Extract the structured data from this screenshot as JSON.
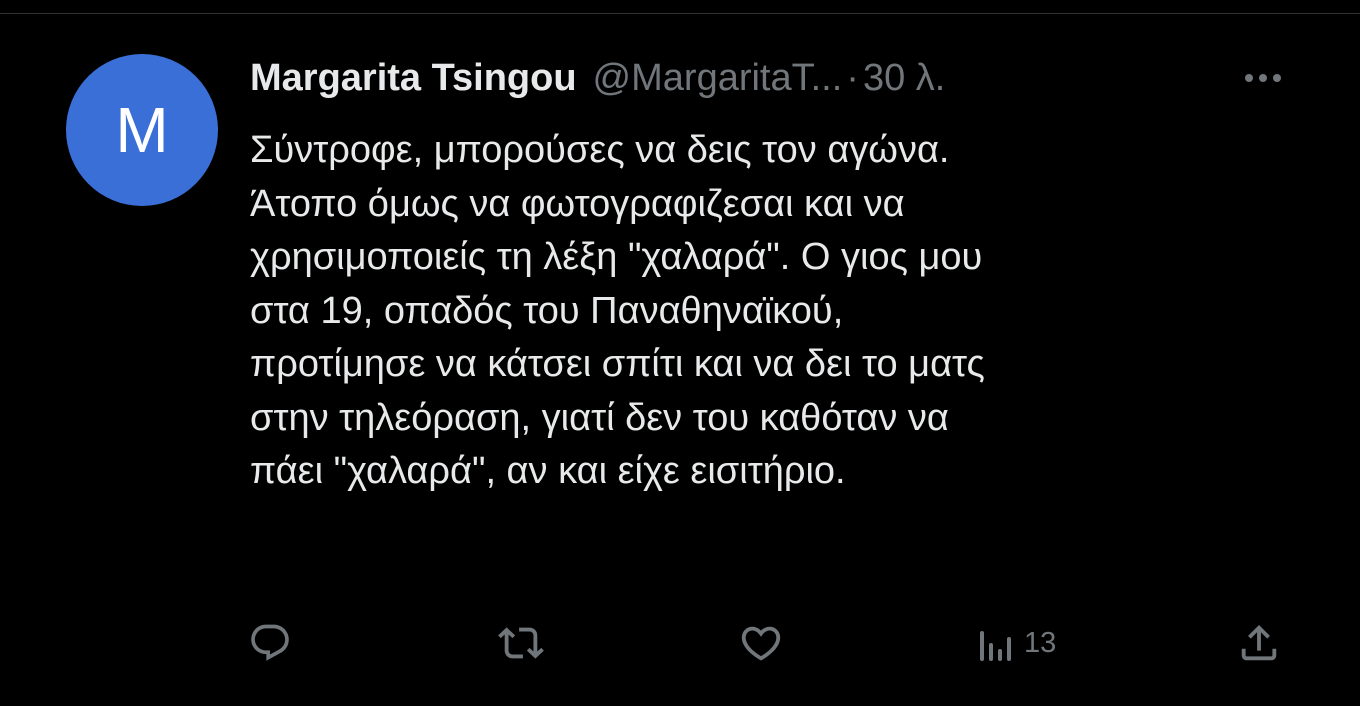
{
  "tweet": {
    "avatar_letter": "M",
    "author_name": "Margarita Tsingou",
    "author_handle": "@MargaritaT...",
    "separator": "·",
    "timestamp": "30 λ.",
    "text": "Σύντροφε, μπορούσες να δεις τον αγώνα.\nΆτοπο όμως να φωτογραφιζεσαι και να\nχρησιμοποιείς τη λέξη \"χαλαρά\". Ο γιος μου\nστα 19, οπαδός του Παναθηναϊκού,\nπροτίμησε να κάτσει σπίτι και να δει το ματς\nστην τηλεόραση, γιατί δεν του καθόταν να\nπάει \"χαλαρά\", αν και είχε εισιτήριο.",
    "views_count": "13"
  },
  "icons": {
    "more": "more-horizontal-icon",
    "reply": "reply-icon",
    "retweet": "retweet-icon",
    "like": "heart-icon",
    "views": "views-icon",
    "share": "share-icon"
  },
  "colors": {
    "background": "#000000",
    "primary_text": "#e7e9ea",
    "secondary_text": "#71767b",
    "avatar": "#3a6fd8",
    "divider": "#2f3336"
  }
}
